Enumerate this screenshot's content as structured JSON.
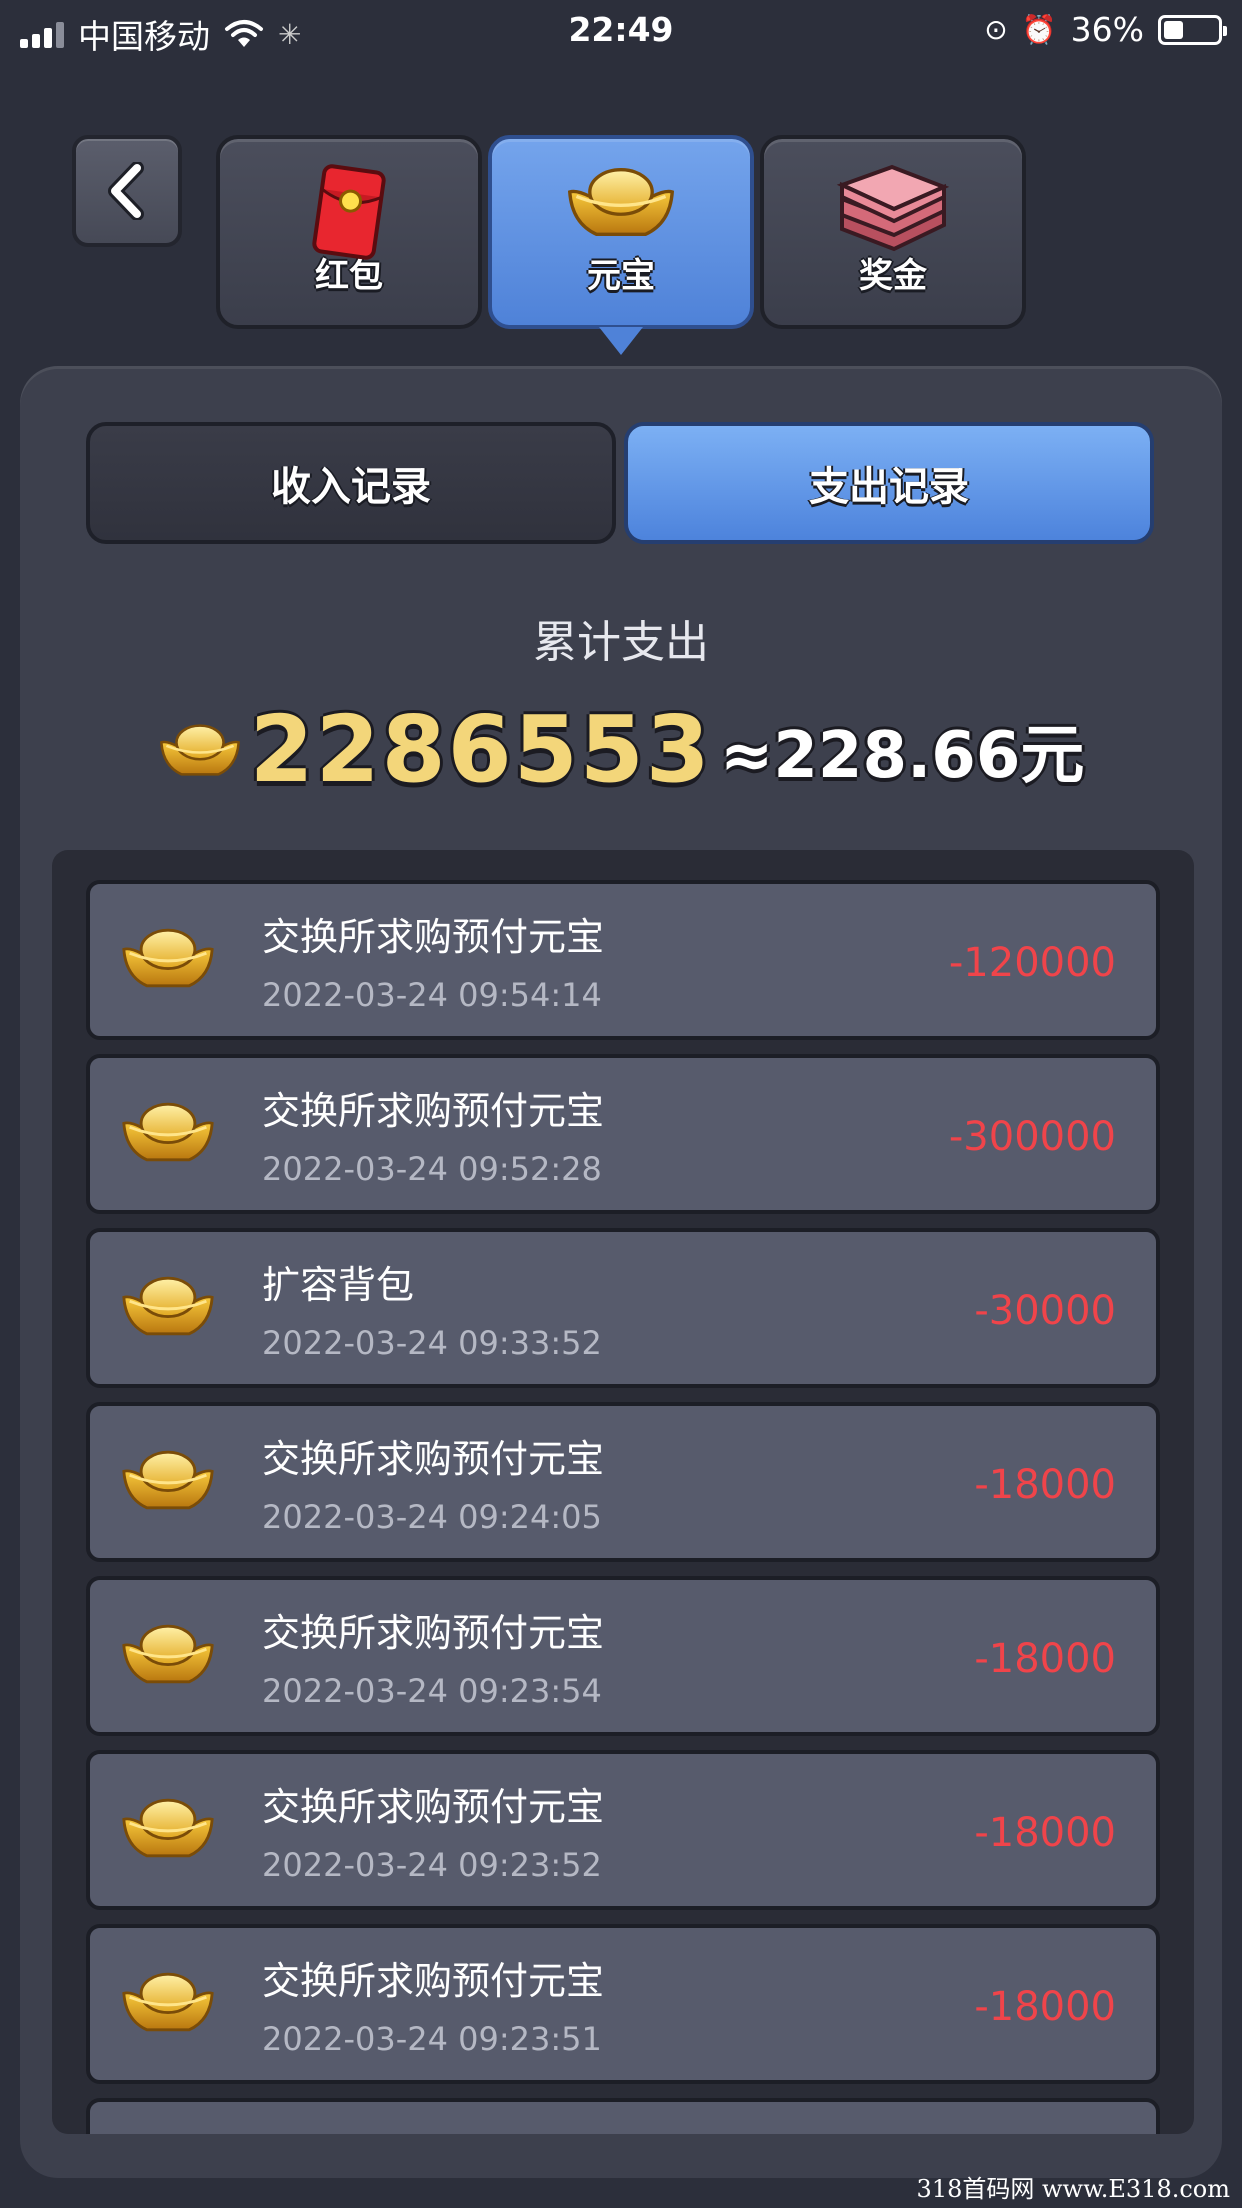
{
  "status_bar": {
    "carrier": "中国移动",
    "time": "22:49",
    "battery": "36%",
    "battery_level": 0.36
  },
  "top_tabs": [
    {
      "label": "红包",
      "icon": "red-envelope-icon",
      "active": false
    },
    {
      "label": "元宝",
      "icon": "gold-ingot-icon",
      "active": true
    },
    {
      "label": "奖金",
      "icon": "cash-bundle-icon",
      "active": false
    }
  ],
  "sub_tabs": {
    "income": "收入记录",
    "expense": "支出记录",
    "active": "expense"
  },
  "summary": {
    "label": "累计支出",
    "amount": "2286553",
    "yuan": "≈228.66元"
  },
  "records": [
    {
      "title": "交换所求购预付元宝",
      "time": "2022-03-24 09:54:14",
      "amount": "-120000"
    },
    {
      "title": "交换所求购预付元宝",
      "time": "2022-03-24 09:52:28",
      "amount": "-300000"
    },
    {
      "title": "扩容背包",
      "time": "2022-03-24 09:33:52",
      "amount": "-30000"
    },
    {
      "title": "交换所求购预付元宝",
      "time": "2022-03-24 09:24:05",
      "amount": "-18000"
    },
    {
      "title": "交换所求购预付元宝",
      "time": "2022-03-24 09:23:54",
      "amount": "-18000"
    },
    {
      "title": "交换所求购预付元宝",
      "time": "2022-03-24 09:23:52",
      "amount": "-18000"
    },
    {
      "title": "交换所求购预付元宝",
      "time": "2022-03-24 09:23:51",
      "amount": "-18000"
    }
  ],
  "watermark": "318首码网 www.E318.com",
  "colors": {
    "background": "#2c2f3b",
    "active_tab": "#5b8fe0",
    "amount_negative": "#f0444a",
    "gold": "#f3d67a"
  }
}
